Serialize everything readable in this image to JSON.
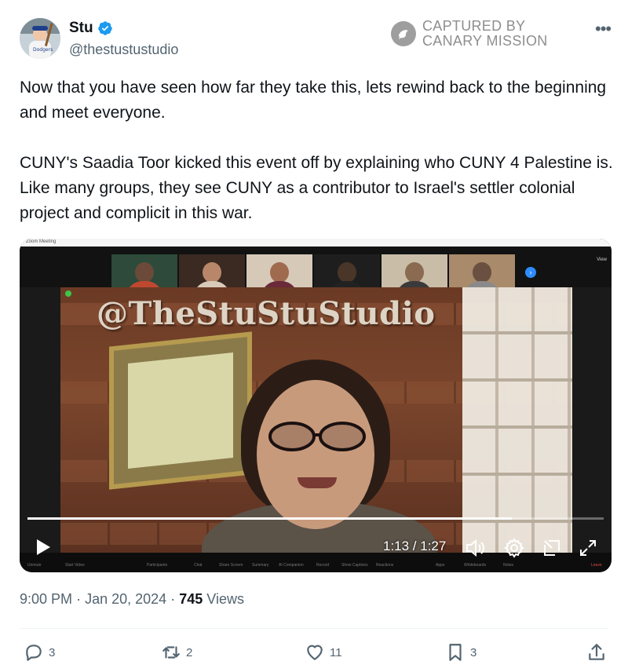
{
  "author": {
    "name": "Stu",
    "handle": "@thestustustudio",
    "verified": true
  },
  "watermark": {
    "line1": "CAPTURED BY",
    "line2": "CANARY MISSION"
  },
  "more_icon": "more-horizontal-icon",
  "tweet": {
    "paragraph1": "Now that you have seen how far they take this, lets rewind back to the beginning and meet everyone.",
    "paragraph2": "CUNY's Saadia Toor kicked this event off by explaining who CUNY 4 Palestine is. Like many groups, they see CUNY as a contributor to Israel's settler colonial project and complicit in this war."
  },
  "video": {
    "zoom_title": "Zoom Meeting",
    "zoom_view": "View",
    "overlay_watermark": "@TheStuStuStudio",
    "current_time": "1:13",
    "duration": "1:27",
    "time_display": "1:13 / 1:27",
    "progress": 0.84,
    "zoom_toolbar": [
      "Unmute",
      "Start Video",
      "Participants",
      "Chat",
      "Share Screen",
      "Summary",
      "AI Companion",
      "Record",
      "Show Captions",
      "Reactions",
      "Apps",
      "Whiteboards",
      "Notes",
      "Leave"
    ]
  },
  "meta": {
    "time": "9:00 PM",
    "separator": "·",
    "date": "Jan 20, 2024",
    "views_count": "745",
    "views_label": "Views"
  },
  "actions": {
    "replies": "3",
    "reposts": "2",
    "likes": "11",
    "bookmarks": "3"
  },
  "colors": {
    "verified": "#1d9bf0",
    "text": "#0f1419",
    "secondary": "#536471"
  }
}
